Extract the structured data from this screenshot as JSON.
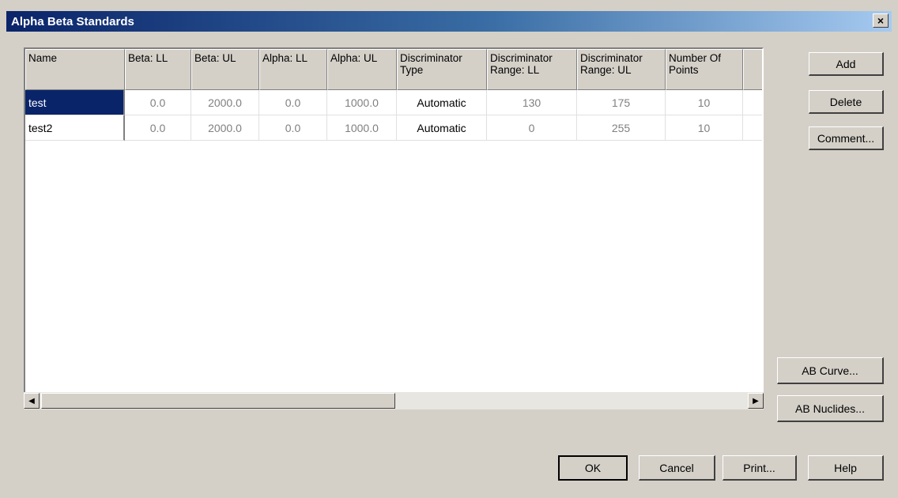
{
  "window": {
    "title": "Alpha Beta Standards",
    "close_label": "×"
  },
  "table": {
    "columns": [
      {
        "label": "Name",
        "width": 126
      },
      {
        "label": "Beta: LL",
        "width": 84
      },
      {
        "label": "Beta: UL",
        "width": 86
      },
      {
        "label": "Alpha: LL",
        "width": 86
      },
      {
        "label": "Alpha: UL",
        "width": 88
      },
      {
        "label": "Discriminator Type",
        "width": 114
      },
      {
        "label": "Discriminator Range: LL",
        "width": 114
      },
      {
        "label": "Discriminator Range: UL",
        "width": 112
      },
      {
        "label": "Number Of Points",
        "width": 98
      }
    ],
    "rows": [
      {
        "name": "test",
        "beta_ll": "0.0",
        "beta_ul": "2000.0",
        "alpha_ll": "0.0",
        "alpha_ul": "1000.0",
        "disc_type": "Automatic",
        "disc_ll": "130",
        "disc_ul": "175",
        "points": "10",
        "selected": true
      },
      {
        "name": "test2",
        "beta_ll": "0.0",
        "beta_ul": "2000.0",
        "alpha_ll": "0.0",
        "alpha_ul": "1000.0",
        "disc_type": "Automatic",
        "disc_ll": "0",
        "disc_ul": "255",
        "points": "10",
        "selected": false
      }
    ]
  },
  "scrollbar": {
    "left_arrow": "◀",
    "right_arrow": "▶"
  },
  "buttons": {
    "add": "Add",
    "delete": "Delete",
    "comment": "Comment...",
    "ab_curve": "AB Curve...",
    "ab_nuclides": "AB Nuclides...",
    "ok": "OK",
    "cancel": "Cancel",
    "print": "Print...",
    "help": "Help"
  }
}
